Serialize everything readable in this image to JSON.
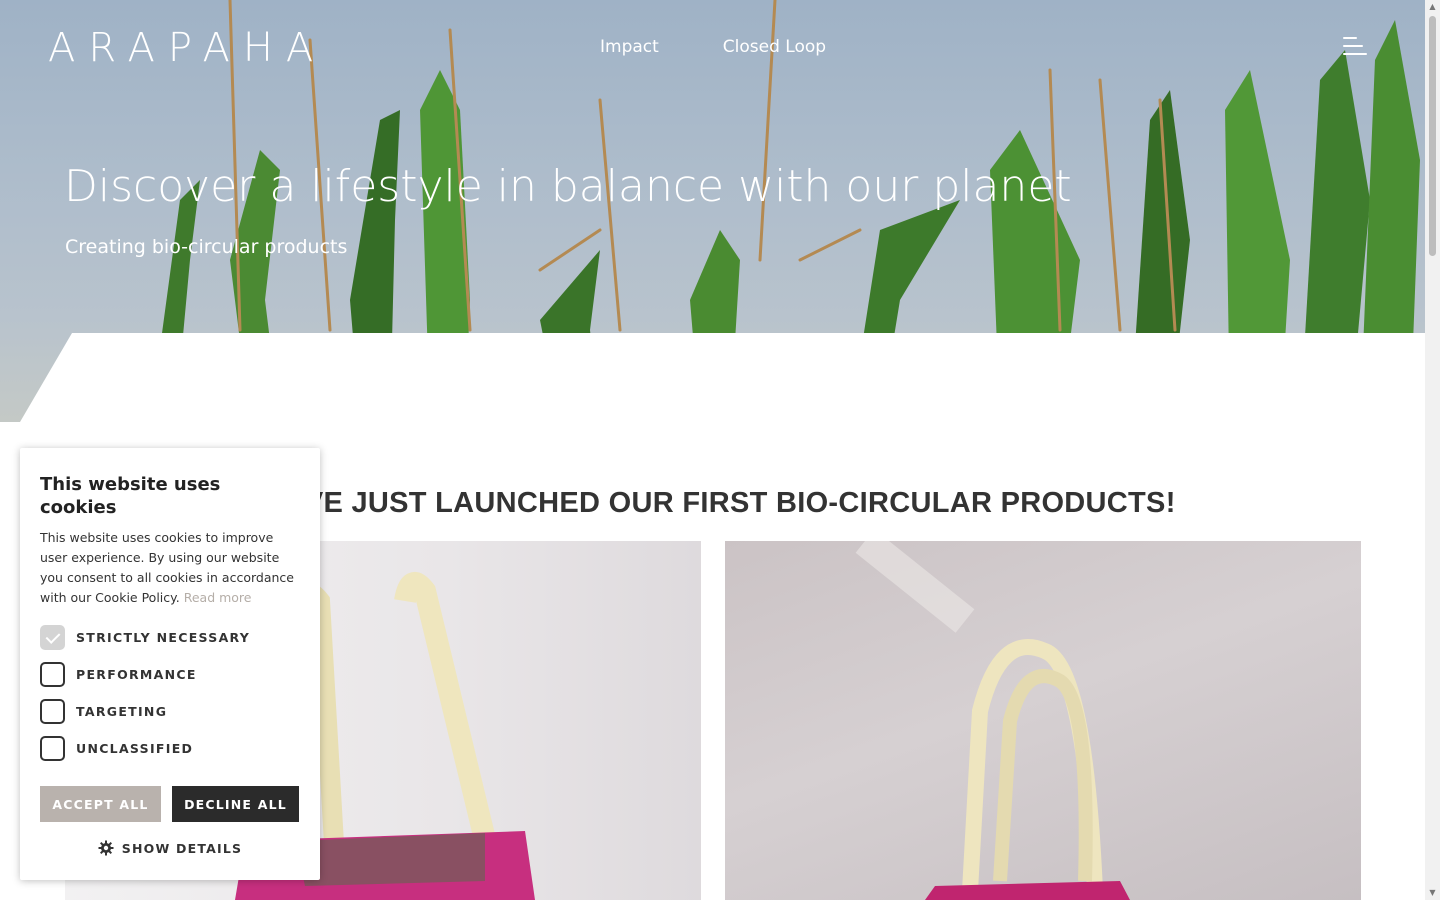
{
  "header": {
    "logo": "ARAPAHA",
    "nav": [
      {
        "label": "Impact"
      },
      {
        "label": "Closed Loop"
      }
    ],
    "menu_icon": "hamburger-menu-icon"
  },
  "hero": {
    "title": "Discover a lifestyle in balance with our planet",
    "subtitle": "Creating bio-circular products"
  },
  "main": {
    "launch_title": "WE'VE JUST LAUNCHED OUR FIRST BIO-CIRCULAR PRODUCTS!",
    "products": [
      {
        "name": "product-image-tote-bag-1"
      },
      {
        "name": "product-image-tote-bag-2"
      }
    ]
  },
  "cookie_banner": {
    "title": "This website uses cookies",
    "text": "This website uses cookies to improve user experience. By using our website you consent to all cookies in accordance with our Cookie Policy.",
    "read_more": "Read more",
    "options": [
      {
        "label": "STRICTLY NECESSARY",
        "checked": true
      },
      {
        "label": "PERFORMANCE",
        "checked": false
      },
      {
        "label": "TARGETING",
        "checked": false
      },
      {
        "label": "UNCLASSIFIED",
        "checked": false
      }
    ],
    "accept_label": "ACCEPT ALL",
    "decline_label": "DECLINE ALL",
    "details_label": "SHOW DETAILS",
    "details_icon": "gear-icon",
    "colors": {
      "accept": "#b9b2ad",
      "decline": "#2b2b2b",
      "read_more": "#b5aea8"
    }
  }
}
